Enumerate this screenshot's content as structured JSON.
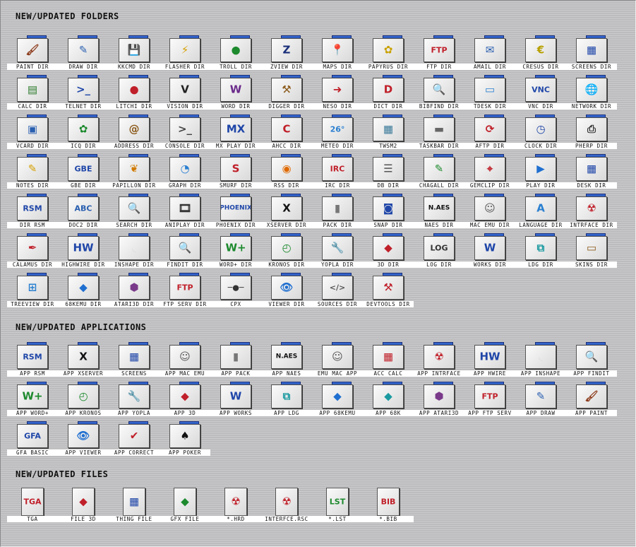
{
  "sections": [
    {
      "title": "NEW/UPDATED FOLDERS",
      "items": [
        {
          "label": "PAINT DIR",
          "icon": "paintbrush-icon",
          "glyph": "🖌",
          "color": "#8b3a1a"
        },
        {
          "label": "DRAW DIR",
          "icon": "pencil-icon",
          "glyph": "✎",
          "color": "#2a5fb0"
        },
        {
          "label": "KKCMD DIR",
          "icon": "floppy-icon",
          "glyph": "💾",
          "color": "#222"
        },
        {
          "label": "FLASHER DIR",
          "icon": "flash-chip-icon",
          "glyph": "⚡",
          "color": "#d6a000"
        },
        {
          "label": "TROLL DIR",
          "icon": "troll-icon",
          "glyph": "●",
          "color": "#1d8a2e"
        },
        {
          "label": "ZVIEW DIR",
          "icon": "zview-icon",
          "glyph": "Z",
          "color": "#1a2f7a"
        },
        {
          "label": "MAPS DIR",
          "icon": "map-pin-icon",
          "glyph": "📍",
          "color": "#c0202a"
        },
        {
          "label": "PAPYRUS DIR",
          "icon": "papyrus-icon",
          "glyph": "✿",
          "color": "#c9a100"
        },
        {
          "label": "FTP DIR",
          "icon": "ftp-globe-icon",
          "glyph": "FTP",
          "color": "#c0202a"
        },
        {
          "label": "AMAIL DIR",
          "icon": "mail-icon",
          "glyph": "✉",
          "color": "#2a5fb0"
        },
        {
          "label": "CRESUS DIR",
          "icon": "cresus-icon",
          "glyph": "€",
          "color": "#b7a000"
        },
        {
          "label": "SCREENS DIR",
          "icon": "screens-icon",
          "glyph": "▦",
          "color": "#1f46a8"
        },
        {
          "label": "CALC DIR",
          "icon": "spreadsheet-icon",
          "glyph": "▤",
          "color": "#2b7a2b"
        },
        {
          "label": "TELNET DIR",
          "icon": "terminal-icon",
          "glyph": ">_",
          "color": "#1f46a8"
        },
        {
          "label": "LITCHI DIR",
          "icon": "litchi-icon",
          "glyph": "●",
          "color": "#c0202a"
        },
        {
          "label": "VISION DIR",
          "icon": "vision-icon",
          "glyph": "V",
          "color": "#222"
        },
        {
          "label": "WORD DIR",
          "icon": "word-doc-icon",
          "glyph": "W",
          "color": "#6a2a8a"
        },
        {
          "label": "DIGGER DIR",
          "icon": "pickaxe-icon",
          "glyph": "⚒",
          "color": "#8b5a1a"
        },
        {
          "label": "NESO DIR",
          "icon": "neso-icon",
          "glyph": "➜",
          "color": "#c0202a"
        },
        {
          "label": "DICT DIR",
          "icon": "dictionary-icon",
          "glyph": "D",
          "color": "#c0202a"
        },
        {
          "label": "BIBFIND DIR",
          "icon": "book-search-icon",
          "glyph": "🔍",
          "color": "#8b3a1a"
        },
        {
          "label": "TDESK DIR",
          "icon": "desktop-icon",
          "glyph": "▭",
          "color": "#2a7fd0"
        },
        {
          "label": "VNC DIR",
          "icon": "vnc-icon",
          "glyph": "VNC",
          "color": "#1f46a8"
        },
        {
          "label": "NETWORK DIR",
          "icon": "network-globe-icon",
          "glyph": "🌐",
          "color": "#555"
        },
        {
          "label": "VCARD DIR",
          "icon": "vcard-icon",
          "glyph": "▣",
          "color": "#2a5fb0"
        },
        {
          "label": "ICQ DIR",
          "icon": "icq-flower-icon",
          "glyph": "✿",
          "color": "#1d8a2e"
        },
        {
          "label": "ADDRESS DIR",
          "icon": "address-book-icon",
          "glyph": "@",
          "color": "#8b5a1a"
        },
        {
          "label": "CONSOLE DIR",
          "icon": "console-icon",
          "glyph": ">_",
          "color": "#444"
        },
        {
          "label": "MX PLAY DIR",
          "icon": "mxplay-icon",
          "glyph": "MX",
          "color": "#1f46a8"
        },
        {
          "label": "AHCC DIR",
          "icon": "ahcc-icon",
          "glyph": "C",
          "color": "#c0202a"
        },
        {
          "label": "METEO DIR",
          "icon": "weather-icon",
          "glyph": "26°",
          "color": "#2a7fd0"
        },
        {
          "label": "TWSM2",
          "icon": "window-manager-icon",
          "glyph": "▦",
          "color": "#3a7a9a"
        },
        {
          "label": "TASKBAR DIR",
          "icon": "taskbar-icon",
          "glyph": "▬",
          "color": "#666"
        },
        {
          "label": "AFTP DIR",
          "icon": "aftp-icon",
          "glyph": "⟳",
          "color": "#c0202a"
        },
        {
          "label": "CLOCK DIR",
          "icon": "clock-icon",
          "glyph": "◷",
          "color": "#1f46a8"
        },
        {
          "label": "PHERP DIR",
          "icon": "printer-icon",
          "glyph": "⎙",
          "color": "#333"
        },
        {
          "label": "NOTES DIR",
          "icon": "notes-icon",
          "glyph": "✎",
          "color": "#d6a000"
        },
        {
          "label": "GBE DIR",
          "icon": "gbe-icon",
          "glyph": "GBE",
          "color": "#1f46a8"
        },
        {
          "label": "PAPILLON DIR",
          "icon": "butterfly-icon",
          "glyph": "❦",
          "color": "#d07a00"
        },
        {
          "label": "GRAPH DIR",
          "icon": "pie-chart-icon",
          "glyph": "◔",
          "color": "#2a7fd0"
        },
        {
          "label": "SMURF DIR",
          "icon": "smurf-icon",
          "glyph": "S",
          "color": "#c0202a"
        },
        {
          "label": "RSS DIR",
          "icon": "rss-icon",
          "glyph": "◉",
          "color": "#e06a00"
        },
        {
          "label": "IRC DIR",
          "icon": "irc-icon",
          "glyph": "IRC",
          "color": "#c0202a"
        },
        {
          "label": "DB DIR",
          "icon": "database-icon",
          "glyph": "☰",
          "color": "#555"
        },
        {
          "label": "CHAGALL DIR",
          "icon": "chagall-icon",
          "glyph": "✎",
          "color": "#1d8a2e"
        },
        {
          "label": "GEMCLIP DIR",
          "icon": "gemclip-icon",
          "glyph": "⌖",
          "color": "#c0202a"
        },
        {
          "label": "PLAY DIR",
          "icon": "play-icon",
          "glyph": "▶",
          "color": "#1f6fd0"
        },
        {
          "label": "DESK DIR",
          "icon": "desk-icon",
          "glyph": "▦",
          "color": "#1f46a8"
        },
        {
          "label": "DIR RSM",
          "icon": "rsm-icon",
          "glyph": "RSM",
          "color": "#1f46a8"
        },
        {
          "label": "DOC2 DIR",
          "icon": "document-icon",
          "glyph": "ABC",
          "color": "#2a5fb0"
        },
        {
          "label": "SEARCH DIR",
          "icon": "magnifier-icon",
          "glyph": "🔍",
          "color": "#1f46a8"
        },
        {
          "label": "ANIPLAY DIR",
          "icon": "film-icon",
          "glyph": "🎞",
          "color": "#333"
        },
        {
          "label": "PHOENIX DIR",
          "icon": "phoenix-icon",
          "glyph": "PHOENIX",
          "color": "#1f46a8"
        },
        {
          "label": "XSERVER DIR",
          "icon": "x-icon",
          "glyph": "X",
          "color": "#111"
        },
        {
          "label": "PACK DIR",
          "icon": "zip-icon",
          "glyph": "▮",
          "color": "#777"
        },
        {
          "label": "SNAP DIR",
          "icon": "camera-icon",
          "glyph": "◙",
          "color": "#1f46a8"
        },
        {
          "label": "NAES DIR",
          "icon": "naes-icon",
          "glyph": "N.AES",
          "color": "#111"
        },
        {
          "label": "MAC EMU DIR",
          "icon": "mac-icon",
          "glyph": "☺",
          "color": "#555"
        },
        {
          "label": "LANGUAGE DIR",
          "icon": "language-icon",
          "glyph": "A",
          "color": "#2a7fd0"
        },
        {
          "label": "INTRFACE DIR",
          "icon": "interface-icon",
          "glyph": "☢",
          "color": "#c0202a"
        },
        {
          "label": "CALAMUS DIR",
          "icon": "quill-icon",
          "glyph": "✒",
          "color": "#c0202a"
        },
        {
          "label": "HIGHWIRE DIR",
          "icon": "highwire-icon",
          "glyph": "HW",
          "color": "#1f46a8"
        },
        {
          "label": "INSHAPE DIR",
          "icon": "inshape-icon",
          "glyph": "◟",
          "color": "#ddd"
        },
        {
          "label": "FINDIT DIR",
          "icon": "findit-icon",
          "glyph": "🔍",
          "color": "#1f46a8"
        },
        {
          "label": "WORD+ DIR",
          "icon": "wordplus-icon",
          "glyph": "W+",
          "color": "#1d8a2e"
        },
        {
          "label": "KRONOS DIR",
          "icon": "stopwatch-icon",
          "glyph": "◴",
          "color": "#1d8a2e"
        },
        {
          "label": "YOPLA DIR",
          "icon": "wrench-icon",
          "glyph": "🔧",
          "color": "#666"
        },
        {
          "label": "3D DIR",
          "icon": "3d-shapes-icon",
          "glyph": "◆",
          "color": "#c0202a"
        },
        {
          "label": "LOG DIR",
          "icon": "log-icon",
          "glyph": "LOG",
          "color": "#333"
        },
        {
          "label": "WORKS DIR",
          "icon": "works-icon",
          "glyph": "W",
          "color": "#1f46a8"
        },
        {
          "label": "LDG DIR",
          "icon": "puzzle-icon",
          "glyph": "⧉",
          "color": "#1a9aa0"
        },
        {
          "label": "SKINS DIR",
          "icon": "skins-icon",
          "glyph": "▭",
          "color": "#8b5a1a"
        },
        {
          "label": "TREEVIEW DIR",
          "icon": "tree-icon",
          "glyph": "⊞",
          "color": "#2a7fd0"
        },
        {
          "label": "68KEMU DIR",
          "icon": "68k-icon",
          "glyph": "◆",
          "color": "#1f6fd0"
        },
        {
          "label": "ATARI3D DIR",
          "icon": "cube-icon",
          "glyph": "⬢",
          "color": "#7a3a8a"
        },
        {
          "label": "FTP SERV DIR",
          "icon": "ftp-server-icon",
          "glyph": "FTP",
          "color": "#c0202a"
        },
        {
          "label": "CPX",
          "icon": "slider-icon",
          "glyph": "─●─",
          "color": "#333"
        },
        {
          "label": "VIEWER DIR",
          "icon": "eye-icon",
          "glyph": "👁",
          "color": "#1f6fd0"
        },
        {
          "label": "SOURCES DIR",
          "icon": "code-icon",
          "glyph": "</>",
          "color": "#555"
        },
        {
          "label": "DEVTOOLS DIR",
          "icon": "tools-icon",
          "glyph": "⚒",
          "color": "#c0202a"
        }
      ]
    },
    {
      "title": "NEW/UPDATED APPLICATIONS",
      "items": [
        {
          "label": "APP RSM",
          "icon": "rsm-app-icon",
          "glyph": "RSM",
          "color": "#1f46a8"
        },
        {
          "label": "APP XSERVER",
          "icon": "x-app-icon",
          "glyph": "X",
          "color": "#111"
        },
        {
          "label": "SCREENS",
          "icon": "screens-app-icon",
          "glyph": "▦",
          "color": "#1f46a8"
        },
        {
          "label": "APP MAC EMU",
          "icon": "mac-app-icon",
          "glyph": "☺",
          "color": "#555"
        },
        {
          "label": "APP PACK",
          "icon": "zip-app-icon",
          "glyph": "▮",
          "color": "#777"
        },
        {
          "label": "APP NAES",
          "icon": "naes-app-icon",
          "glyph": "N.AES",
          "color": "#111"
        },
        {
          "label": "EMU MAC APP",
          "icon": "mac-emu-app-icon",
          "glyph": "☺",
          "color": "#555"
        },
        {
          "label": "ACC CALC",
          "icon": "calculator-icon",
          "glyph": "▦",
          "color": "#c0202a"
        },
        {
          "label": "APP INTRFACE",
          "icon": "interface-app-icon",
          "glyph": "☢",
          "color": "#c0202a"
        },
        {
          "label": "APP HWIRE",
          "icon": "highwire-app-icon",
          "glyph": "HW",
          "color": "#1f46a8"
        },
        {
          "label": "APP INSHAPE",
          "icon": "inshape-app-icon",
          "glyph": "◟",
          "color": "#ddd"
        },
        {
          "label": "APP FINDIT",
          "icon": "findit-app-icon",
          "glyph": "🔍",
          "color": "#1f46a8"
        },
        {
          "label": "APP WORD+",
          "icon": "wordplus-app-icon",
          "glyph": "W+",
          "color": "#1d8a2e"
        },
        {
          "label": "APP KRONOS",
          "icon": "stopwatch-app-icon",
          "glyph": "◴",
          "color": "#1d8a2e"
        },
        {
          "label": "APP YOPLA",
          "icon": "wrench-app-icon",
          "glyph": "🔧",
          "color": "#666"
        },
        {
          "label": "APP 3D",
          "icon": "3d-app-icon",
          "glyph": "◆",
          "color": "#c0202a"
        },
        {
          "label": "APP WORKS",
          "icon": "works-app-icon",
          "glyph": "W",
          "color": "#1f46a8"
        },
        {
          "label": "APP LDG",
          "icon": "puzzle-app-icon",
          "glyph": "⧉",
          "color": "#1a9aa0"
        },
        {
          "label": "APP 68KEMU",
          "icon": "68kemu-app-icon",
          "glyph": "◆",
          "color": "#1f6fd0"
        },
        {
          "label": "APP 68K",
          "icon": "68k-app-icon",
          "glyph": "◆",
          "color": "#1a9aa0"
        },
        {
          "label": "APP ATARI3D",
          "icon": "cube-app-icon",
          "glyph": "⬢",
          "color": "#7a3a8a"
        },
        {
          "label": "APP FTP SERV",
          "icon": "ftp-server-app-icon",
          "glyph": "FTP",
          "color": "#c0202a"
        },
        {
          "label": "APP DRAW",
          "icon": "pencil-app-icon",
          "glyph": "✎",
          "color": "#2a5fb0"
        },
        {
          "label": "APP PAINT",
          "icon": "paintbrush-app-icon",
          "glyph": "🖌",
          "color": "#8b3a1a"
        },
        {
          "label": "GFA BASIC",
          "icon": "gfa-basic-icon",
          "glyph": "GFA",
          "color": "#1f46a8"
        },
        {
          "label": "APP VIEWER",
          "icon": "eye-app-icon",
          "glyph": "👁",
          "color": "#1f6fd0"
        },
        {
          "label": "APP CORRECT",
          "icon": "correct-app-icon",
          "glyph": "✔",
          "color": "#c0202a"
        },
        {
          "label": "APP POKER",
          "icon": "cards-icon",
          "glyph": "♠",
          "color": "#111"
        }
      ]
    },
    {
      "title": "NEW/UPDATED FILES",
      "items": [
        {
          "label": "TGA",
          "icon": "image-file-icon",
          "glyph": "TGA",
          "color": "#c0202a"
        },
        {
          "label": "FILE 3D",
          "icon": "3d-file-icon",
          "glyph": "◆",
          "color": "#c0202a"
        },
        {
          "label": "THING FILE",
          "icon": "thing-file-icon",
          "glyph": "▦",
          "color": "#1f46a8"
        },
        {
          "label": "GFX FILE",
          "icon": "gfx-file-icon",
          "glyph": "◆",
          "color": "#1d8a2e"
        },
        {
          "label": "*.HRD",
          "icon": "hrd-file-icon",
          "glyph": "☢",
          "color": "#c0202a"
        },
        {
          "label": "INTERFCE.RSC",
          "icon": "rsc-file-icon",
          "glyph": "☢",
          "color": "#c0202a"
        },
        {
          "label": "*.LST",
          "icon": "lst-file-icon",
          "glyph": "LST",
          "color": "#1d8a2e"
        },
        {
          "label": "*.BIB",
          "icon": "bib-file-icon",
          "glyph": "BIB",
          "color": "#c0202a"
        }
      ]
    }
  ]
}
